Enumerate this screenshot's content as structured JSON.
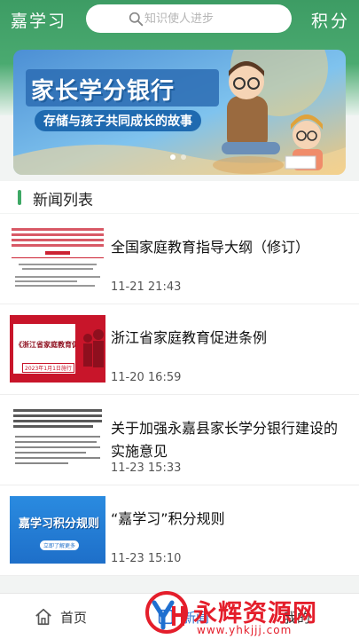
{
  "header": {
    "title": "嘉学习",
    "search_placeholder": "知识使人进步",
    "points_label": "积分"
  },
  "banner": {
    "title": "家长学分银行",
    "subtitle": "存储与孩子共同成长的故事",
    "slides": 2,
    "active_slide": 0
  },
  "section": {
    "title": "新闻列表"
  },
  "news": [
    {
      "title": "全国家庭教育指导大纲（修订）",
      "date": "11-21 21:43",
      "thumb": "document"
    },
    {
      "title": "浙江省家庭教育促进条例",
      "date": "11-20 16:59",
      "thumb": "red-poster",
      "thumb_text": "《浙江省家庭教育促进条例》",
      "thumb_date": "2023年1月1日施行"
    },
    {
      "title": "关于加强永嘉县家长学分银行建设的实施意见",
      "date": "11-23 15:33",
      "thumb": "document"
    },
    {
      "title": "“嘉学习”积分规则",
      "date": "11-23 15:10",
      "thumb": "blue-poster",
      "thumb_text": "嘉学习积分规则",
      "thumb_button": "立即了解更多"
    }
  ],
  "tabbar": {
    "home_label": "首页",
    "news_label": "新闻",
    "mine_label": "我的"
  },
  "watermark": {
    "text": "永辉资源网",
    "url": "www.yhkjjj.com"
  },
  "colors": {
    "primary_green": "#3d9c64",
    "accent_red": "#e41e2b",
    "banner_blue": "#2c6cb3"
  }
}
